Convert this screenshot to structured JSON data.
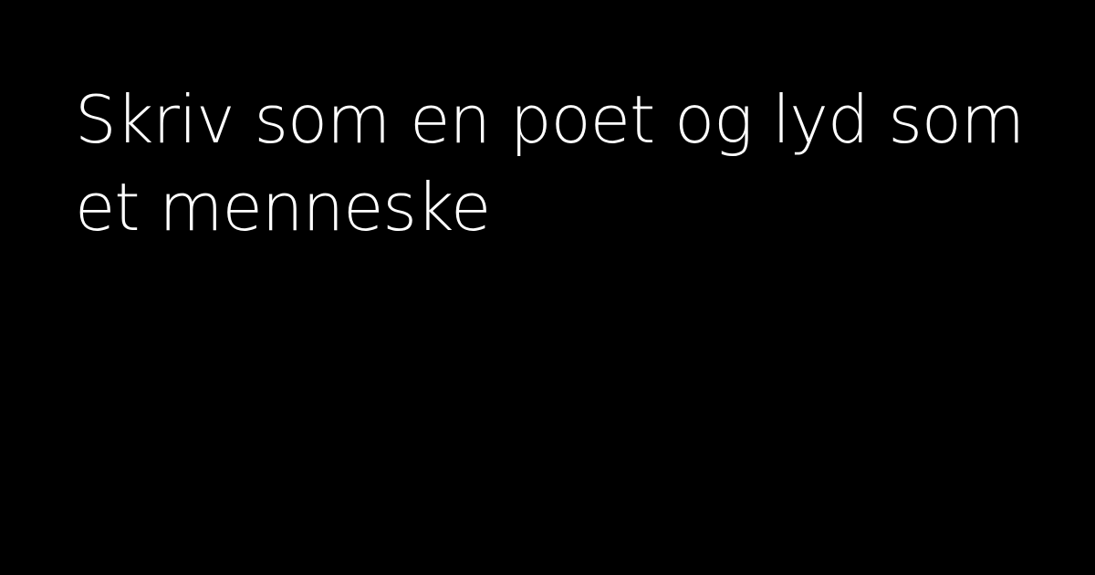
{
  "card": {
    "headline": "Skriv som en poet og lyd som et menneske",
    "background_color": "#000000",
    "text_color": "#ffffff"
  }
}
